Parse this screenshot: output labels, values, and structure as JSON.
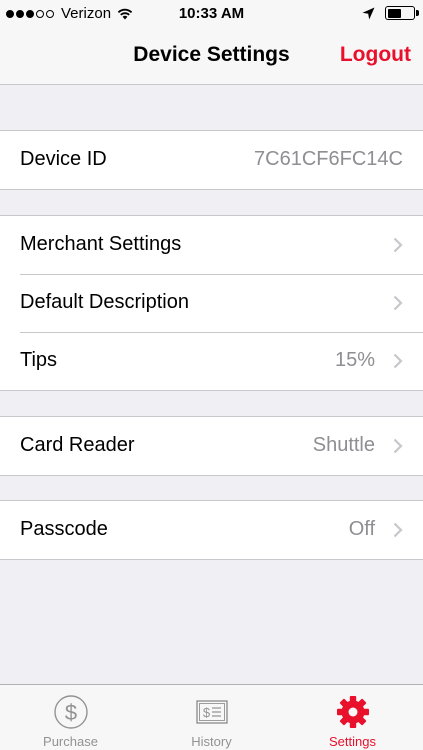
{
  "status_bar": {
    "carrier": "Verizon",
    "time": "10:33 AM",
    "signal_bars": 3,
    "signal_total": 5,
    "battery_level": 0.55
  },
  "nav": {
    "title": "Device Settings",
    "logout_label": "Logout"
  },
  "settings": {
    "device_id": {
      "label": "Device ID",
      "value": "7C61CF6FC14C"
    },
    "merchant_settings": {
      "label": "Merchant Settings"
    },
    "default_description": {
      "label": "Default Description"
    },
    "tips": {
      "label": "Tips",
      "value": "15%"
    },
    "card_reader": {
      "label": "Card Reader",
      "value": "Shuttle"
    },
    "passcode": {
      "label": "Passcode",
      "value": "Off"
    }
  },
  "tabs": [
    {
      "label": "Purchase",
      "icon": "dollar-circle-icon",
      "active": false
    },
    {
      "label": "History",
      "icon": "receipt-icon",
      "active": false
    },
    {
      "label": "Settings",
      "icon": "gear-icon",
      "active": true
    }
  ],
  "colors": {
    "accent": "#e8102a",
    "inactive_tab": "#929292",
    "background": "#efeff4",
    "secondary_text": "#8e8e93"
  }
}
